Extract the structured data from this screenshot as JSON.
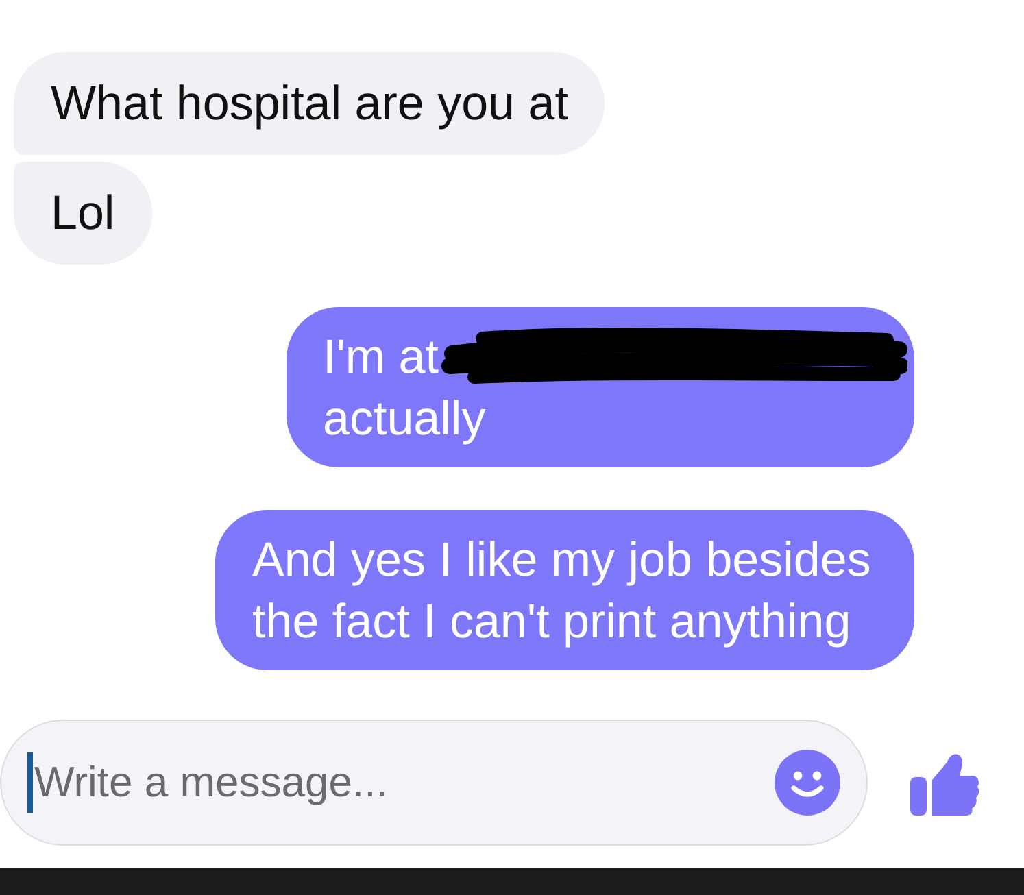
{
  "messages": [
    {
      "kind": "received",
      "joined": false,
      "text": "What hospital are you at"
    },
    {
      "kind": "received",
      "joined": true,
      "text": "Lol"
    },
    {
      "kind": "sent",
      "joined": false,
      "text": "I'm at",
      "redacted": true,
      "text_after": "actually"
    },
    {
      "kind": "sent",
      "joined": false,
      "text": "And yes I like my job besides the fact I can't print anything"
    }
  ],
  "composer": {
    "placeholder": "Write a message...",
    "focused": true
  }
}
